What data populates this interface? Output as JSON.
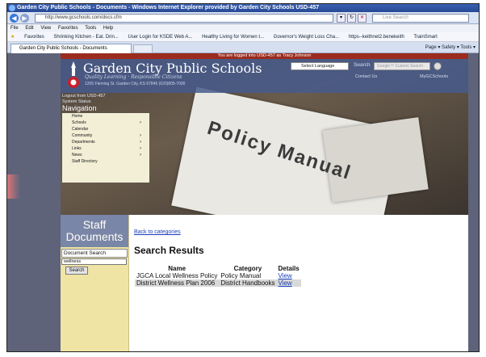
{
  "browser": {
    "window_title": "Garden City Public Schools - Documents - Windows Internet Explorer provided by Garden City Schools USD-457",
    "url": "http://www.gcschools.com/docs.cfm",
    "live_search_placeholder": "Live Search",
    "menu": [
      "File",
      "Edit",
      "View",
      "Favorites",
      "Tools",
      "Help"
    ],
    "favorites_label": "Favorites",
    "favorites_links": [
      "Shrinking Kitchen - Eat. Drin...",
      "User Login for KSDE Web A...",
      "Healthy Living for Women t...",
      "Governor's Weight Loss Cha...",
      "https--keithnet2.benekeith",
      "TrainSmart"
    ],
    "tab_label": "Garden City Public Schools - Documents",
    "tab_tools": "Page ▾  Safety ▾  Tools ▾"
  },
  "site": {
    "logged_in": "You are logged into USD-457 as Tracy Johnson",
    "school_name": "Garden City Public Schools",
    "tagline": "Quality Learning · Responsible Citizens",
    "address": "1205 Fleming St. Garden City, KS 67846 (620)805-7000",
    "select_language": "Select Language",
    "search_label": "Search",
    "search_placeholder": "Google™ Custom Search",
    "contact_us": "Contact Us",
    "my_gcs": "MyGCSchools",
    "logout": "Logout from USD-457",
    "system_status": "System Status",
    "navigation_title": "Navigation",
    "nav_items": [
      {
        "label": "Home",
        "arrow": ""
      },
      {
        "label": "Schools",
        "arrow": "›"
      },
      {
        "label": "Calendar",
        "arrow": ""
      },
      {
        "label": "Community",
        "arrow": "›"
      },
      {
        "label": "Departments",
        "arrow": "›"
      },
      {
        "label": "Links",
        "arrow": "›"
      },
      {
        "label": "News",
        "arrow": "›"
      },
      {
        "label": "Staff Directory",
        "arrow": ""
      }
    ],
    "banner_text": "Policy Manual"
  },
  "sidebar": {
    "title": "Staff Documents",
    "doc_search_label": "Document Search",
    "doc_search_value": "wellness",
    "search_button": "Search"
  },
  "main": {
    "back_link": "Back to categories",
    "results_title": "Search Results",
    "columns": [
      "Name",
      "Category",
      "Details"
    ],
    "rows": [
      {
        "name": "JGCA Local Wellness Policy",
        "category": "Policy Manual",
        "details": "View"
      },
      {
        "name": "District Wellness Plan 2006",
        "category": "District Handbooks",
        "details": "View"
      }
    ]
  }
}
